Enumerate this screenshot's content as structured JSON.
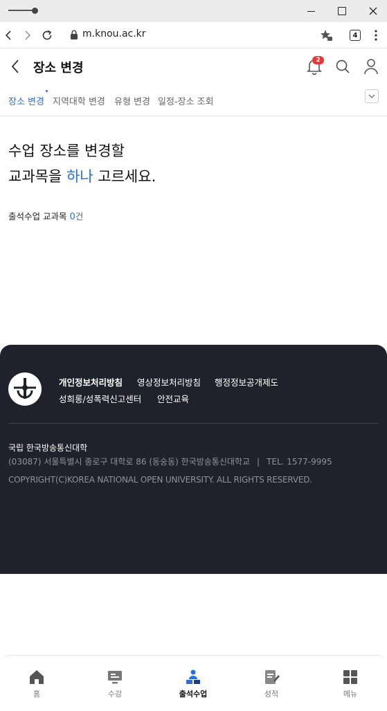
{
  "browser": {
    "url": "m.knou.ac.kr",
    "tab_count": "4"
  },
  "header": {
    "title": "장소 변경",
    "notification_count": "2"
  },
  "tabs": [
    {
      "label": "장소 변경",
      "active": true
    },
    {
      "label": "지역대학 변경",
      "active": false
    },
    {
      "label": "유형 변경",
      "active": false
    },
    {
      "label": "일정-장소 조회",
      "active": false
    }
  ],
  "main": {
    "headline_line1": "수업 장소를 변경할",
    "headline_line2_pre": "교과목을 ",
    "headline_line2_accent": "하나",
    "headline_line2_post": " 고르세요.",
    "count_label": "출석수업 교과목 ",
    "count_value": "0",
    "count_unit": "건"
  },
  "footer": {
    "links": [
      "개인정보처리방침",
      "영상정보처리방침",
      "행정정보공개제도",
      "성희롱/성폭력신고센터",
      "안전교육"
    ],
    "university": "국립 한국방송통신대학",
    "address": "(03087) 서울특별시 종로구 대학로 86 (동숭동) 한국방송통신대학교",
    "separator": "|",
    "tel": "TEL. 1577-9995",
    "copyright": "COPYRIGHT(C)KOREA NATIONAL OPEN UNIVERSITY. ALL RIGHTS RESERVED."
  },
  "bottom_nav": [
    {
      "label": "홈",
      "icon": "home-icon",
      "active": false
    },
    {
      "label": "수강",
      "icon": "monitor-icon",
      "active": false
    },
    {
      "label": "출석수업",
      "icon": "attendance-icon",
      "active": true
    },
    {
      "label": "성적",
      "icon": "grade-icon",
      "active": false
    },
    {
      "label": "메뉴",
      "icon": "grid-icon",
      "active": false
    }
  ],
  "colors": {
    "accent": "#2b6fd6",
    "footer_bg": "#1f222b",
    "badge": "#e53935"
  }
}
